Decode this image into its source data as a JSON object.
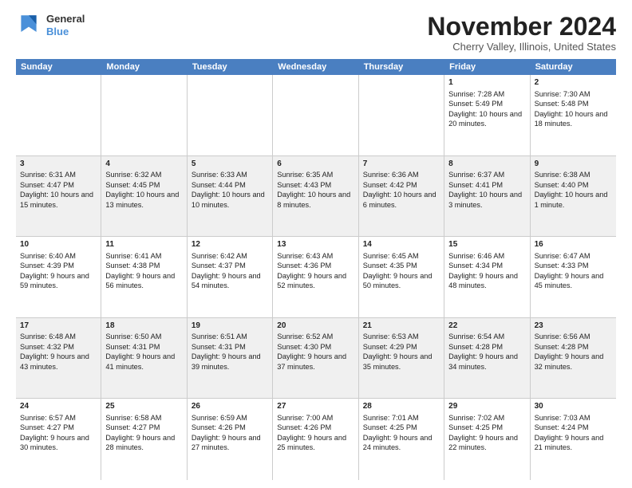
{
  "logo": {
    "general": "General",
    "blue": "Blue"
  },
  "title": "November 2024",
  "subtitle": "Cherry Valley, Illinois, United States",
  "days": [
    "Sunday",
    "Monday",
    "Tuesday",
    "Wednesday",
    "Thursday",
    "Friday",
    "Saturday"
  ],
  "weeks": [
    [
      {
        "day": "",
        "info": ""
      },
      {
        "day": "",
        "info": ""
      },
      {
        "day": "",
        "info": ""
      },
      {
        "day": "",
        "info": ""
      },
      {
        "day": "",
        "info": ""
      },
      {
        "day": "1",
        "info": "Sunrise: 7:28 AM\nSunset: 5:49 PM\nDaylight: 10 hours and 20 minutes."
      },
      {
        "day": "2",
        "info": "Sunrise: 7:30 AM\nSunset: 5:48 PM\nDaylight: 10 hours and 18 minutes."
      }
    ],
    [
      {
        "day": "3",
        "info": "Sunrise: 6:31 AM\nSunset: 4:47 PM\nDaylight: 10 hours and 15 minutes."
      },
      {
        "day": "4",
        "info": "Sunrise: 6:32 AM\nSunset: 4:45 PM\nDaylight: 10 hours and 13 minutes."
      },
      {
        "day": "5",
        "info": "Sunrise: 6:33 AM\nSunset: 4:44 PM\nDaylight: 10 hours and 10 minutes."
      },
      {
        "day": "6",
        "info": "Sunrise: 6:35 AM\nSunset: 4:43 PM\nDaylight: 10 hours and 8 minutes."
      },
      {
        "day": "7",
        "info": "Sunrise: 6:36 AM\nSunset: 4:42 PM\nDaylight: 10 hours and 6 minutes."
      },
      {
        "day": "8",
        "info": "Sunrise: 6:37 AM\nSunset: 4:41 PM\nDaylight: 10 hours and 3 minutes."
      },
      {
        "day": "9",
        "info": "Sunrise: 6:38 AM\nSunset: 4:40 PM\nDaylight: 10 hours and 1 minute."
      }
    ],
    [
      {
        "day": "10",
        "info": "Sunrise: 6:40 AM\nSunset: 4:39 PM\nDaylight: 9 hours and 59 minutes."
      },
      {
        "day": "11",
        "info": "Sunrise: 6:41 AM\nSunset: 4:38 PM\nDaylight: 9 hours and 56 minutes."
      },
      {
        "day": "12",
        "info": "Sunrise: 6:42 AM\nSunset: 4:37 PM\nDaylight: 9 hours and 54 minutes."
      },
      {
        "day": "13",
        "info": "Sunrise: 6:43 AM\nSunset: 4:36 PM\nDaylight: 9 hours and 52 minutes."
      },
      {
        "day": "14",
        "info": "Sunrise: 6:45 AM\nSunset: 4:35 PM\nDaylight: 9 hours and 50 minutes."
      },
      {
        "day": "15",
        "info": "Sunrise: 6:46 AM\nSunset: 4:34 PM\nDaylight: 9 hours and 48 minutes."
      },
      {
        "day": "16",
        "info": "Sunrise: 6:47 AM\nSunset: 4:33 PM\nDaylight: 9 hours and 45 minutes."
      }
    ],
    [
      {
        "day": "17",
        "info": "Sunrise: 6:48 AM\nSunset: 4:32 PM\nDaylight: 9 hours and 43 minutes."
      },
      {
        "day": "18",
        "info": "Sunrise: 6:50 AM\nSunset: 4:31 PM\nDaylight: 9 hours and 41 minutes."
      },
      {
        "day": "19",
        "info": "Sunrise: 6:51 AM\nSunset: 4:31 PM\nDaylight: 9 hours and 39 minutes."
      },
      {
        "day": "20",
        "info": "Sunrise: 6:52 AM\nSunset: 4:30 PM\nDaylight: 9 hours and 37 minutes."
      },
      {
        "day": "21",
        "info": "Sunrise: 6:53 AM\nSunset: 4:29 PM\nDaylight: 9 hours and 35 minutes."
      },
      {
        "day": "22",
        "info": "Sunrise: 6:54 AM\nSunset: 4:28 PM\nDaylight: 9 hours and 34 minutes."
      },
      {
        "day": "23",
        "info": "Sunrise: 6:56 AM\nSunset: 4:28 PM\nDaylight: 9 hours and 32 minutes."
      }
    ],
    [
      {
        "day": "24",
        "info": "Sunrise: 6:57 AM\nSunset: 4:27 PM\nDaylight: 9 hours and 30 minutes."
      },
      {
        "day": "25",
        "info": "Sunrise: 6:58 AM\nSunset: 4:27 PM\nDaylight: 9 hours and 28 minutes."
      },
      {
        "day": "26",
        "info": "Sunrise: 6:59 AM\nSunset: 4:26 PM\nDaylight: 9 hours and 27 minutes."
      },
      {
        "day": "27",
        "info": "Sunrise: 7:00 AM\nSunset: 4:26 PM\nDaylight: 9 hours and 25 minutes."
      },
      {
        "day": "28",
        "info": "Sunrise: 7:01 AM\nSunset: 4:25 PM\nDaylight: 9 hours and 24 minutes."
      },
      {
        "day": "29",
        "info": "Sunrise: 7:02 AM\nSunset: 4:25 PM\nDaylight: 9 hours and 22 minutes."
      },
      {
        "day": "30",
        "info": "Sunrise: 7:03 AM\nSunset: 4:24 PM\nDaylight: 9 hours and 21 minutes."
      }
    ]
  ]
}
